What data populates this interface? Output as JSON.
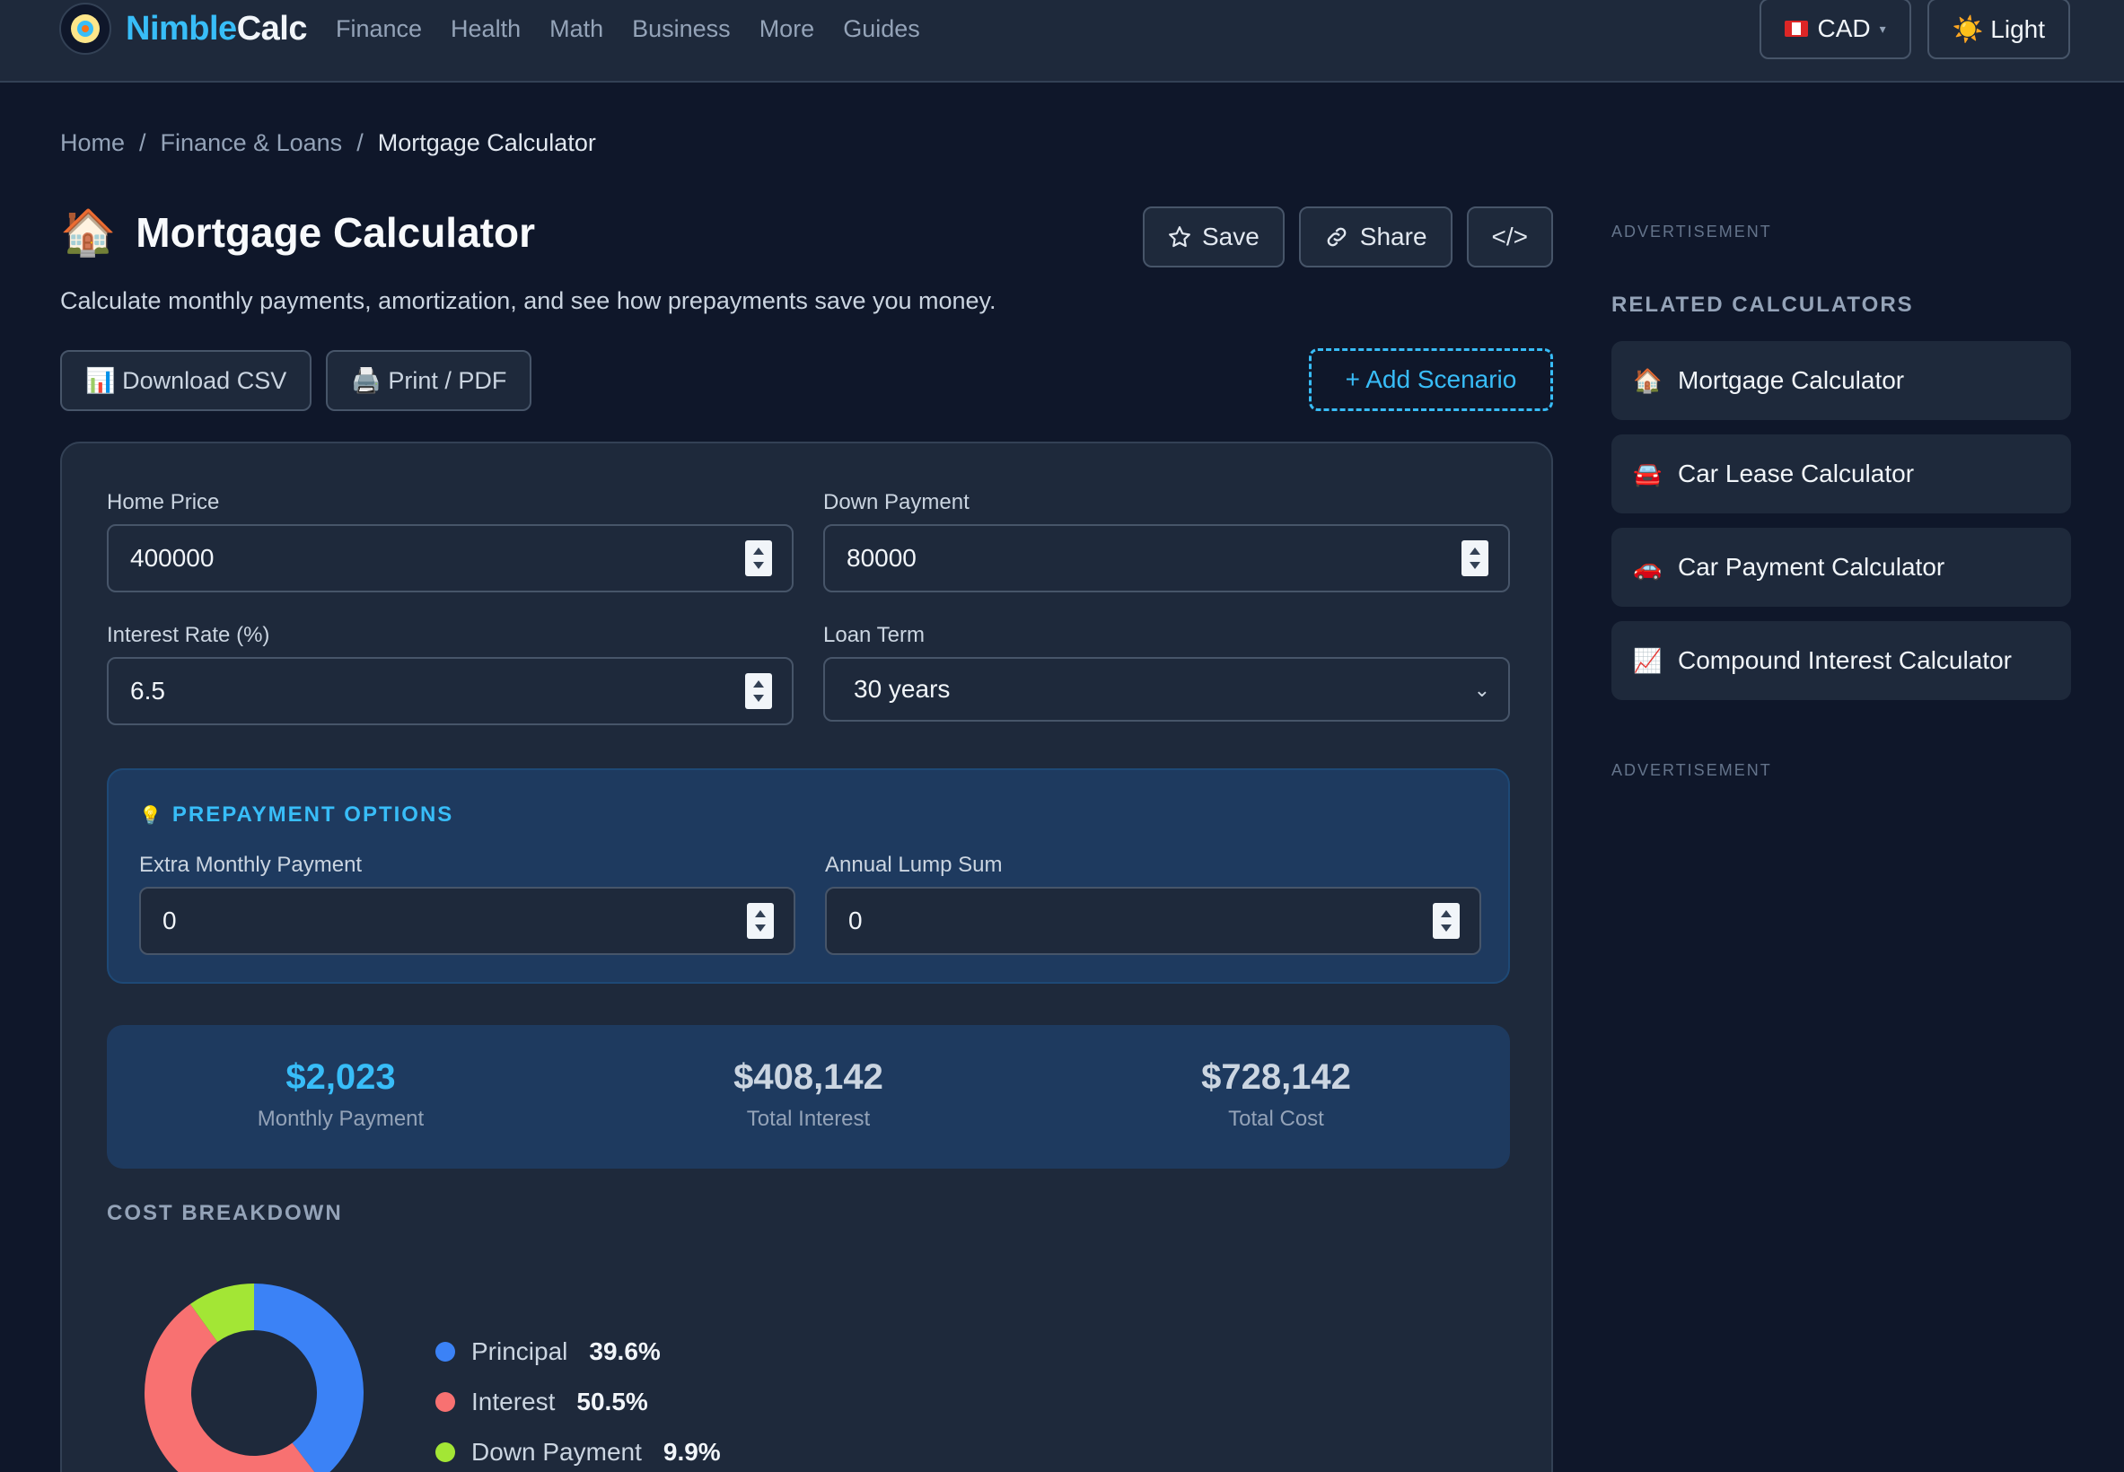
{
  "nav": {
    "brand_a": "Nimble",
    "brand_b": "Calc",
    "links": [
      "Finance",
      "Health",
      "Math",
      "Business",
      "More",
      "Guides"
    ],
    "currency": "CAD",
    "theme": "☀️ Light"
  },
  "breadcrumb": {
    "items": [
      "Home",
      "Finance & Loans"
    ],
    "current": "Mortgage Calculator",
    "sep": "/"
  },
  "header": {
    "emoji": "🏠",
    "title": "Mortgage Calculator",
    "subtitle": "Calculate monthly payments, amortization, and see how prepayments save you money.",
    "save": "Save",
    "share": "Share",
    "embed": "</>",
    "download": "📊 Download CSV",
    "print": "🖨️ Print / PDF",
    "add_scenario": "+ Add Scenario"
  },
  "form": {
    "home_price_label": "Home Price",
    "home_price": "400000",
    "down_payment_label": "Down Payment",
    "down_payment": "80000",
    "interest_label": "Interest Rate (%)",
    "interest": "6.5",
    "term_label": "Loan Term",
    "term": "30 years"
  },
  "prepay": {
    "icon": "💡",
    "title": "PREPAYMENT OPTIONS",
    "extra_label": "Extra Monthly Payment",
    "extra": "0",
    "lump_label": "Annual Lump Sum",
    "lump": "0"
  },
  "results": {
    "monthly": "$2,023",
    "monthly_label": "Monthly Payment",
    "interest": "$408,142",
    "interest_label": "Total Interest",
    "total": "$728,142",
    "total_label": "Total Cost"
  },
  "breakdown": {
    "title": "COST BREAKDOWN",
    "items": [
      {
        "name": "Principal",
        "pct": "39.6%",
        "value": 39.6,
        "color": "#3b82f6"
      },
      {
        "name": "Interest",
        "pct": "50.5%",
        "value": 50.5,
        "color": "#f87171"
      },
      {
        "name": "Down Payment",
        "pct": "9.9%",
        "value": 9.9,
        "color": "#a3e635"
      }
    ]
  },
  "sidebar": {
    "ad": "ADVERTISEMENT",
    "title": "RELATED CALCULATORS",
    "items": [
      {
        "emoji": "🏠",
        "label": "Mortgage Calculator"
      },
      {
        "emoji": "🚘",
        "label": "Car Lease Calculator"
      },
      {
        "emoji": "🚗",
        "label": "Car Payment Calculator"
      },
      {
        "emoji": "📈",
        "label": "Compound Interest Calculator"
      }
    ]
  }
}
